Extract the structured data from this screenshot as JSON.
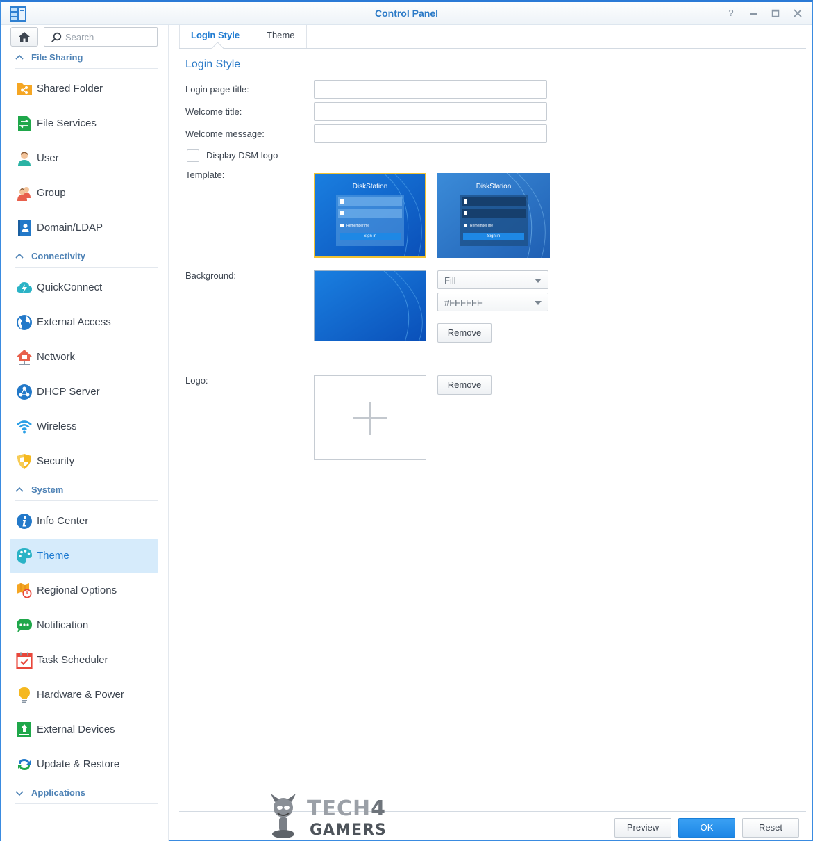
{
  "window": {
    "title": "Control Panel",
    "controls": [
      "help",
      "minimize",
      "maximize",
      "close"
    ]
  },
  "sidebar": {
    "search": {
      "placeholder": "Search",
      "value": ""
    },
    "sections": [
      {
        "label": "File Sharing",
        "expanded": true,
        "items": [
          {
            "label": "Shared Folder",
            "icon": "shared-folder-icon"
          },
          {
            "label": "File Services",
            "icon": "file-services-icon"
          },
          {
            "label": "User",
            "icon": "user-icon"
          },
          {
            "label": "Group",
            "icon": "group-icon"
          },
          {
            "label": "Domain/LDAP",
            "icon": "domain-ldap-icon"
          }
        ]
      },
      {
        "label": "Connectivity",
        "expanded": true,
        "items": [
          {
            "label": "QuickConnect",
            "icon": "quickconnect-icon"
          },
          {
            "label": "External Access",
            "icon": "external-access-icon"
          },
          {
            "label": "Network",
            "icon": "network-icon"
          },
          {
            "label": "DHCP Server",
            "icon": "dhcp-server-icon"
          },
          {
            "label": "Wireless",
            "icon": "wireless-icon"
          },
          {
            "label": "Security",
            "icon": "security-icon"
          }
        ]
      },
      {
        "label": "System",
        "expanded": true,
        "items": [
          {
            "label": "Info Center",
            "icon": "info-center-icon"
          },
          {
            "label": "Theme",
            "icon": "theme-icon",
            "active": true
          },
          {
            "label": "Regional Options",
            "icon": "regional-options-icon"
          },
          {
            "label": "Notification",
            "icon": "notification-icon"
          },
          {
            "label": "Task Scheduler",
            "icon": "task-scheduler-icon"
          },
          {
            "label": "Hardware & Power",
            "icon": "hardware-power-icon"
          },
          {
            "label": "External Devices",
            "icon": "external-devices-icon"
          },
          {
            "label": "Update & Restore",
            "icon": "update-restore-icon"
          }
        ]
      },
      {
        "label": "Applications",
        "expanded": false,
        "items": []
      }
    ]
  },
  "tabs": [
    {
      "label": "Login Style",
      "active": true
    },
    {
      "label": "Theme",
      "active": false
    }
  ],
  "login_style": {
    "section_title": "Login Style",
    "login_page_title": {
      "label": "Login page title:",
      "value": ""
    },
    "welcome_title": {
      "label": "Welcome title:",
      "value": ""
    },
    "welcome_message": {
      "label": "Welcome message:",
      "value": ""
    },
    "display_dsm_logo": {
      "label": "Display DSM logo",
      "checked": false
    },
    "template": {
      "label": "Template:",
      "options": [
        {
          "heading": "DiskStation",
          "remember": "Remember me",
          "button": "Sign in",
          "selected": true
        },
        {
          "heading": "DiskStation",
          "remember": "Remember me",
          "button": "Sign in",
          "selected": false
        }
      ]
    },
    "background": {
      "label": "Background:",
      "fill_mode": "Fill",
      "color": "#FFFFFF",
      "remove_label": "Remove"
    },
    "logo": {
      "label": "Logo:",
      "remove_label": "Remove"
    }
  },
  "footer": {
    "preview_label": "Preview",
    "ok_label": "OK",
    "reset_label": "Reset"
  },
  "watermark": {
    "line1": "TECH",
    "line1_suffix": "4",
    "line2": "GAMERS"
  },
  "colors": {
    "accent": "#1d7ad1",
    "active_nav_bg": "#d6ebfb",
    "template_selected_outline": "#f1c232",
    "primary_button": "#1d87e6"
  }
}
